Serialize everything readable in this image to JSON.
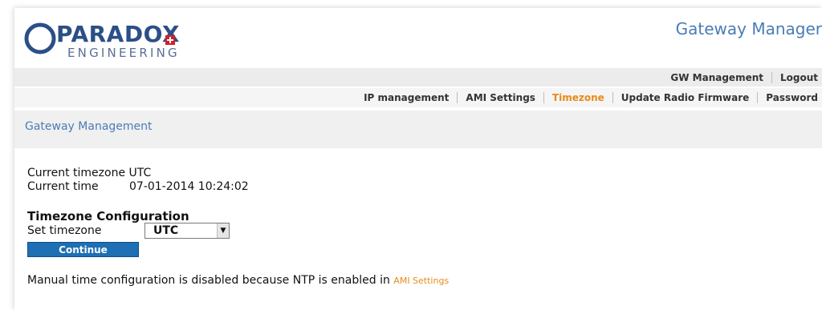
{
  "header": {
    "logo_text": "PARADOX",
    "logo_subtext": "ENGINEERING",
    "app_title": "Gateway Manager"
  },
  "nav_primary": [
    {
      "label": "GW Management"
    },
    {
      "label": "Logout"
    }
  ],
  "nav_secondary": [
    {
      "label": "IP management",
      "active": false
    },
    {
      "label": "AMI Settings",
      "active": false
    },
    {
      "label": "Timezone",
      "active": true
    },
    {
      "label": "Update Radio Firmware",
      "active": false
    },
    {
      "label": "Password",
      "active": false
    }
  ],
  "page": {
    "heading": "Gateway Management"
  },
  "timezone": {
    "current_timezone_label": "Current timezone",
    "current_timezone_value": "UTC",
    "current_time_label": "Current time",
    "current_time_value": "07-01-2014 10:24:02",
    "config_title": "Timezone Configuration",
    "set_timezone_label": "Set timezone",
    "set_timezone_value": "UTC",
    "continue_label": "Continue",
    "ntp_note": "Manual time configuration is disabled because NTP is enabled in",
    "ntp_link": "AMI Settings"
  },
  "colors": {
    "accent_blue": "#4a7cb5",
    "active_orange": "#e88a1a",
    "button_blue": "#1e6fb4",
    "logo_blue": "#2b4f86"
  },
  "icons": {
    "logo": "paradox-globe-logo",
    "select_arrow": "chevron-down-icon"
  }
}
